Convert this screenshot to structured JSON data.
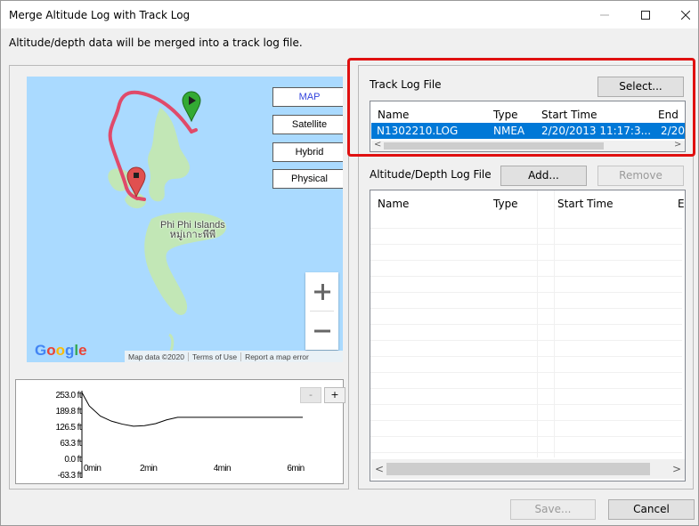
{
  "window": {
    "title": "Merge Altitude Log with Track Log"
  },
  "description": "Altitude/depth data will be merged into a track log file.",
  "map": {
    "buttons": [
      "MAP",
      "Satellite",
      "Hybrid",
      "Physical"
    ],
    "active_button": "MAP",
    "zoom_in": "+",
    "zoom_out": "−",
    "logo": "Google",
    "footer": [
      "Map data ©2020",
      "Terms of Use",
      "Report a map error"
    ],
    "place_label_line1": "Phi Phi Islands",
    "place_label_line2": "หมู่เกาะพีพี",
    "colors": {
      "water": "#aadaff",
      "land": "#c2e7b6",
      "track": "#e04a6a",
      "start_marker": "#33aa33",
      "end_marker": "#e05050"
    }
  },
  "altitude_chart": {
    "minus": "-",
    "plus": "+"
  },
  "chart_data": {
    "type": "line",
    "y_tick_labels": [
      "253.0 ft",
      "189.8 ft",
      "126.5 ft",
      "63.3 ft",
      "0.0 ft",
      "-63.3 ft"
    ],
    "x_tick_labels": [
      "0min",
      "2min",
      "4min",
      "6min"
    ],
    "ylim": [
      -63.3,
      253.0
    ],
    "xlim": [
      0,
      6
    ],
    "grid": false,
    "series": [
      {
        "x": [
          0,
          0.2,
          0.5,
          0.8,
          1.1,
          1.4,
          1.7,
          2.0,
          2.3,
          2.6,
          3.0,
          4.0,
          5.0,
          6.0
        ],
        "y": [
          253.0,
          200,
          160,
          140,
          128,
          120,
          122,
          130,
          145,
          155,
          155,
          155,
          155,
          155
        ]
      }
    ]
  },
  "track_log": {
    "label": "Track Log File",
    "select_button": "Select...",
    "columns": [
      "Name",
      "Type",
      "Start Time",
      "End"
    ],
    "rows": [
      {
        "name": "N1302210.LOG",
        "type": "NMEA",
        "start": "2/20/2013 11:17:3...",
        "end": "2/20"
      }
    ]
  },
  "altitude_log": {
    "label": "Altitude/Depth Log File",
    "add_button": "Add...",
    "remove_button": "Remove",
    "columns": [
      "Name",
      "Type",
      "Start Time",
      "E"
    ]
  },
  "footer": {
    "save_button": "Save...",
    "cancel_button": "Cancel"
  },
  "colors": {
    "selection": "#0078d7",
    "highlight_box": "#e01010"
  }
}
